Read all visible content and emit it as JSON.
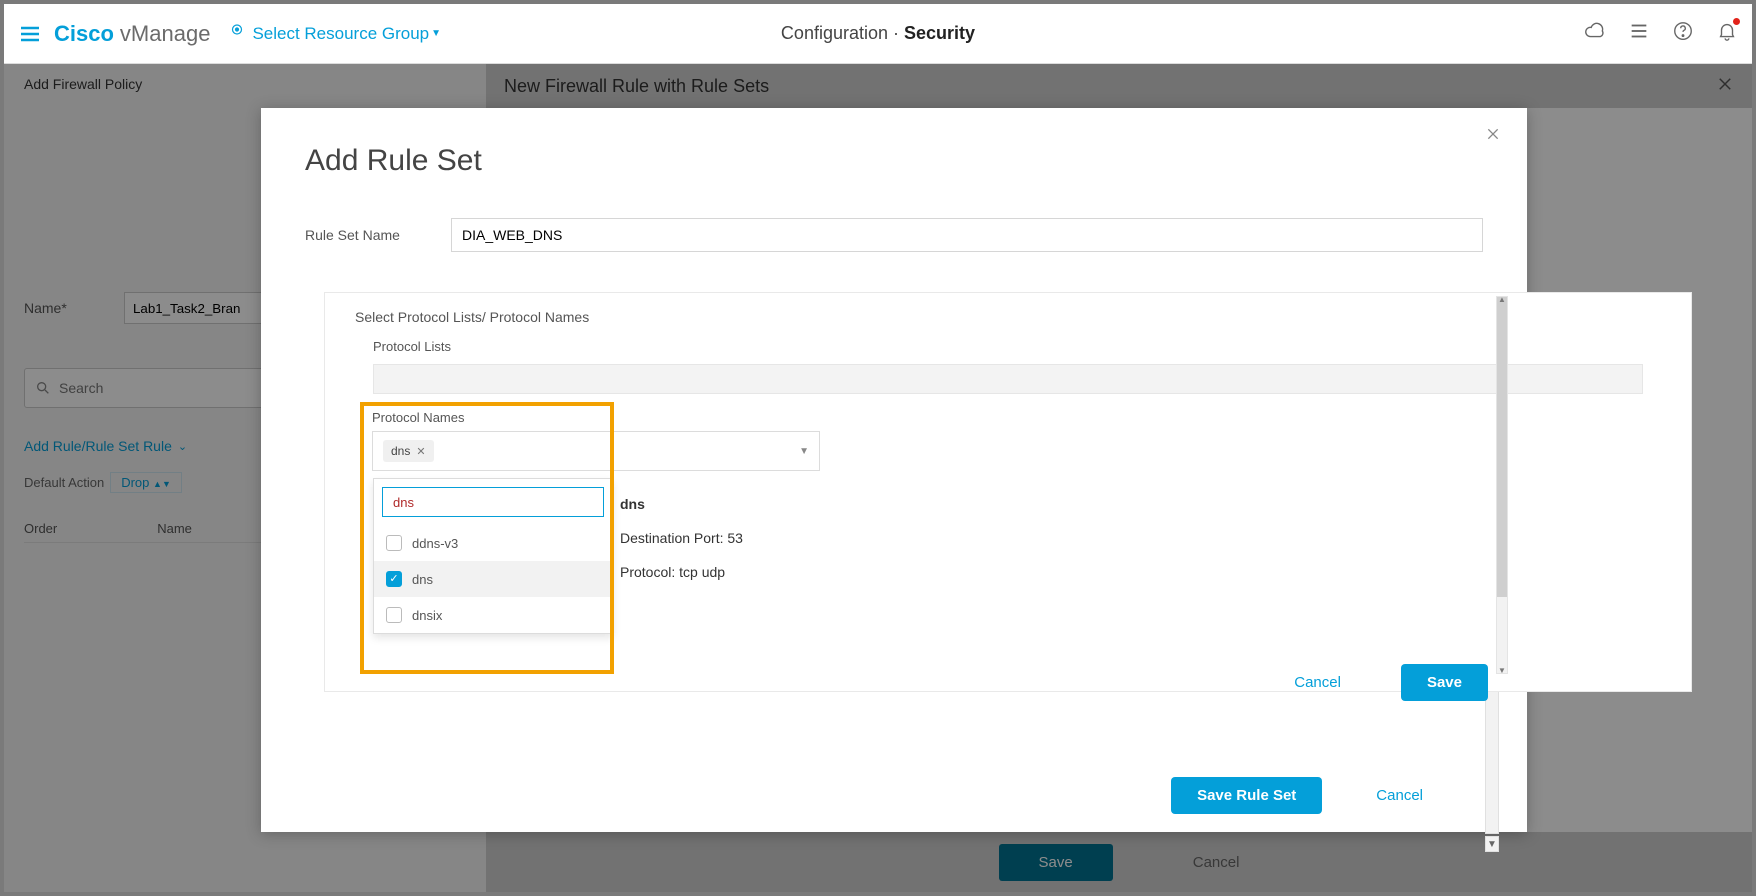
{
  "header": {
    "brand_bold": "Cisco",
    "brand_light": "vManage",
    "resource_group": "Select Resource Group",
    "breadcrumb_pre": "Configuration",
    "breadcrumb_sep": " · ",
    "breadcrumb_cur": "Security"
  },
  "left": {
    "title": "Add Firewall Policy",
    "name_label": "Name*",
    "name_value": "Lab1_Task2_Bran",
    "search_placeholder": "Search",
    "add_rule": "Add Rule/Rule Set Rule",
    "default_action_label": "Default Action",
    "default_action_value": "Drop",
    "col_order": "Order",
    "col_name": "Name"
  },
  "secpanel": {
    "title": "New Firewall Rule with Rule Sets"
  },
  "modal": {
    "title": "Add Rule Set",
    "ruleset_name_label": "Rule Set Name",
    "ruleset_name_value": "DIA_WEB_DNS",
    "section_header": "Select Protocol Lists/ Protocol Names",
    "protocol_lists_label": "Protocol Lists",
    "protocol_names_label": "Protocol Names",
    "chip_value": "dns",
    "search_value": "dns",
    "options": [
      {
        "label": "ddns-v3",
        "checked": false
      },
      {
        "label": "dns",
        "checked": true
      },
      {
        "label": "dnsix",
        "checked": false
      }
    ],
    "detail": {
      "name": "dns",
      "port_label": "Destination Port:",
      "port_value": "53",
      "protocol_label": "Protocol:",
      "protocol_value": "tcp udp"
    },
    "cancel": "Cancel",
    "save": "Save",
    "save_ruleset": "Save Rule Set",
    "cancel2": "Cancel"
  },
  "outer": {
    "save": "Save",
    "cancel": "Cancel"
  }
}
